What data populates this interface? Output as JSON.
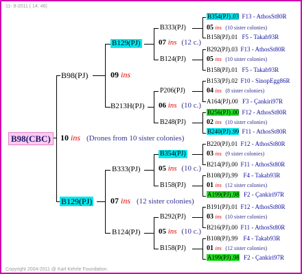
{
  "stamp_top": "11-  8-2011 ( 14: 46)",
  "stamp_bottom": "Copyright 2004-2011 @ Karl Kehrle Foundation.",
  "root": {
    "label": "B98(CBC)"
  },
  "root_link": {
    "num": "10",
    "ins": "ins",
    "note": "(Drones from 10 sister colonies)"
  },
  "g1": [
    {
      "label": "B98(PJ)",
      "num": "09",
      "ins": "ins"
    },
    {
      "label": "B129(PJ)",
      "num": "07",
      "ins": "ins",
      "note": "(12 sister colonies)"
    }
  ],
  "g2": [
    {
      "label": "B129(PJ)",
      "num": "07",
      "ins": "ins",
      "note": "(12 c.)"
    },
    {
      "label": "B213H(PJ)",
      "num": "06",
      "ins": "ins",
      "note": "(10 c.)"
    },
    {
      "label": "B333(PJ)",
      "num": "05",
      "ins": "ins",
      "note": "(10 c.)"
    },
    {
      "label": "B124(PJ)",
      "num": "05",
      "ins": "ins",
      "note": "(10 c.)"
    }
  ],
  "g3": [
    {
      "label": "B333(PJ)",
      "num": "05",
      "ins": "ins",
      "note": "(10 sister colonies)"
    },
    {
      "label": "B124(PJ)",
      "num": "05",
      "ins": "ins",
      "note": "(10 sister colonies)"
    },
    {
      "label": "P206(PJ)",
      "num": "04",
      "ins": "ins",
      "note": "(8 sister colonies)"
    },
    {
      "label": "B248(PJ)",
      "num": "02",
      "ins": "ins",
      "note": "(10 sister colonies)"
    },
    {
      "label": "B354(PJ)",
      "num": "03",
      "ins": "ins",
      "note": "(9 sister colonies)"
    },
    {
      "label": "B158(PJ)",
      "num": "01",
      "ins": "ins",
      "note": "(12 sister colonies)"
    },
    {
      "label": "B292(PJ)",
      "num": "03",
      "ins": "ins",
      "note": "(10 sister colonies)"
    },
    {
      "label": "B158(PJ)",
      "num": "01",
      "ins": "ins",
      "note": "(12 sister colonies)"
    }
  ],
  "g4": [
    {
      "id": "B354(PJ)",
      "year": ".03",
      "line": "F13 - AthosSt80R"
    },
    {
      "id": "B158(PJ)",
      "year": ".01",
      "line": "F5 - Takab93R"
    },
    {
      "id": "B292(PJ)",
      "year": ".03",
      "line": "F13 - AthosSt80R"
    },
    {
      "id": "B158(PJ)",
      "year": ".01",
      "line": "F5 - Takab93R"
    },
    {
      "id": "B153(PJ)",
      "year": ".02",
      "line": "F10 - SinopEgg86R"
    },
    {
      "id": "A164(PJ)",
      "year": ".00",
      "line": "F3 - Çankiri97R"
    },
    {
      "id": "B256(PJ)",
      "year": ".00",
      "line": "F12 - AthosSt80R"
    },
    {
      "id": "B240(PJ)",
      "year": ".99",
      "line": "F11 - AthosSt80R"
    },
    {
      "id": "B220(PJ)",
      "year": ".01",
      "line": "F12 - AthosSt80R"
    },
    {
      "id": "B214(PJ)",
      "year": ".00",
      "line": "F11 - AthosSt80R"
    },
    {
      "id": "B108(PJ)",
      "year": ".99",
      "line": "F4 - Takab93R"
    },
    {
      "id": "A199(PJ)",
      "year": ".98",
      "line": "F2 - Çankiri97R"
    },
    {
      "id": "B191(PJ)",
      "year": ".01",
      "line": "F12 - AthosSt80R"
    },
    {
      "id": "B216(PJ)",
      "year": ".00",
      "line": "F11 - AthosSt80R"
    },
    {
      "id": "B108(PJ)",
      "year": ".99",
      "line": "F4 - Takab93R"
    },
    {
      "id": "A199(PJ)",
      "year": ".98",
      "line": "F2 - Çankiri97R"
    }
  ]
}
